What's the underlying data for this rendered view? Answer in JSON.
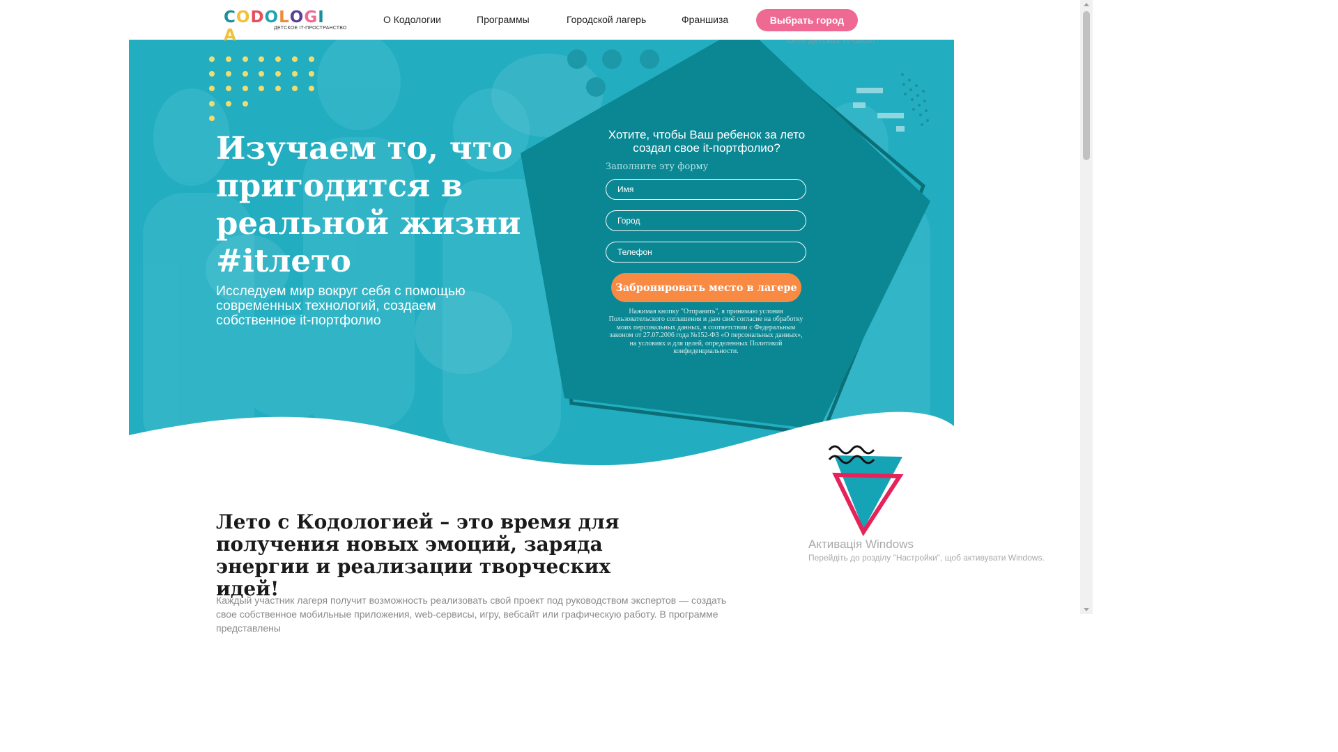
{
  "brand": {
    "logo_text": "CODOLOGIA",
    "tagline": "ДЕТСКОЕ IT-ПРОСТРАНСТВО"
  },
  "nav": {
    "items": [
      {
        "label": "О Кодологии"
      },
      {
        "label": "Программы"
      },
      {
        "label": "Городской лагерь"
      },
      {
        "label": "Франшиза"
      }
    ],
    "city_button": "Выбрать город"
  },
  "hero": {
    "background_caption": "сеть детских IT-школ",
    "title": "Изучаем то, что пригодится в реальной жизни #itлето",
    "subtitle": "Исследуем мир вокруг себя с помощью современных технологий, создаем собственное it-портфолио"
  },
  "form": {
    "title": "Хотите, чтобы Ваш ребенок за лето создал свое it-портфолио?",
    "hint": "Заполните эту форму",
    "name_placeholder": "Имя",
    "city_placeholder": "Город",
    "phone_placeholder": "Телефон",
    "submit_label": "Забронировать место в лагере",
    "consent": "Нажимая кнопку \"Отправить\", я принимаю условия Пользовательского соглашения и даю своё согласие на обработку моих персональных данных, в соответствии с Федеральным законом от 27.07.2006 года №152-ФЗ «О персональных данных», на условиях и для целей, определенных Политикой конфиденциальности."
  },
  "section": {
    "title": "Лето с Кодологией – это время для получения новых эмоций, заряда энергии и реализации творческих идей!",
    "text": "Каждый участник лагеря получит возможность реализовать свой проект под руководством экспертов — создать свое собственное мобильные приложения, web-сервисы, игру, вебсайт или графическую работу. В программе представлены"
  },
  "windows_watermark": {
    "title": "Активація Windows",
    "subtitle": "Перейдіть до розділу \"Настройки\", щоб активувати Windows."
  },
  "colors": {
    "teal": "#22adc0",
    "dark_teal": "#0a8793",
    "pink": "#ef6a92",
    "orange": "#f98a43",
    "yellow_dots": "#f3dc6e",
    "triangle_red": "#e5235a"
  }
}
